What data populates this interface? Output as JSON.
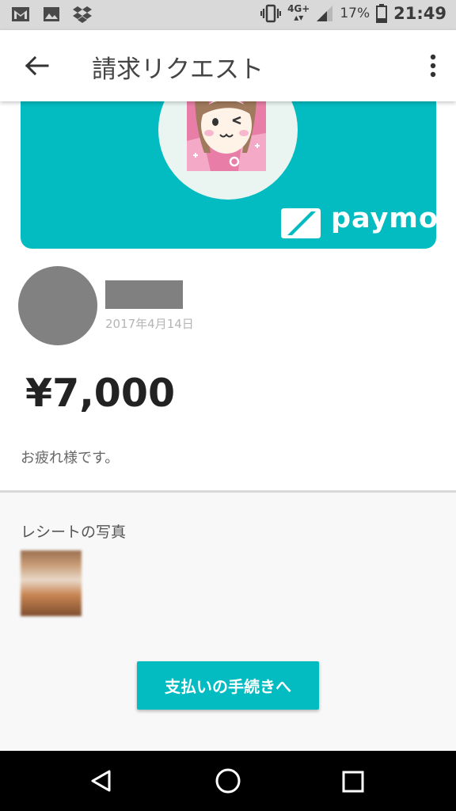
{
  "status_bar": {
    "network": "4G+",
    "battery": "17%",
    "time": "21:49"
  },
  "app_bar": {
    "title": "請求リクエスト"
  },
  "banner": {
    "brand": "paymo",
    "color": "#02bcc1"
  },
  "request": {
    "date": "2017年4月14日",
    "amount": "¥7,000",
    "message": "お疲れ様です。"
  },
  "receipt": {
    "label": "レシートの写真"
  },
  "actions": {
    "pay_label": "支払いの手続きへ"
  },
  "icons": [
    "gmail-icon",
    "photos-icon",
    "dropbox-icon",
    "vibrate-icon",
    "signal-icon",
    "battery-icon",
    "back-arrow-icon",
    "more-vert-icon",
    "paymo-logo-icon",
    "nav-back-icon",
    "nav-home-icon",
    "nav-recents-icon"
  ]
}
